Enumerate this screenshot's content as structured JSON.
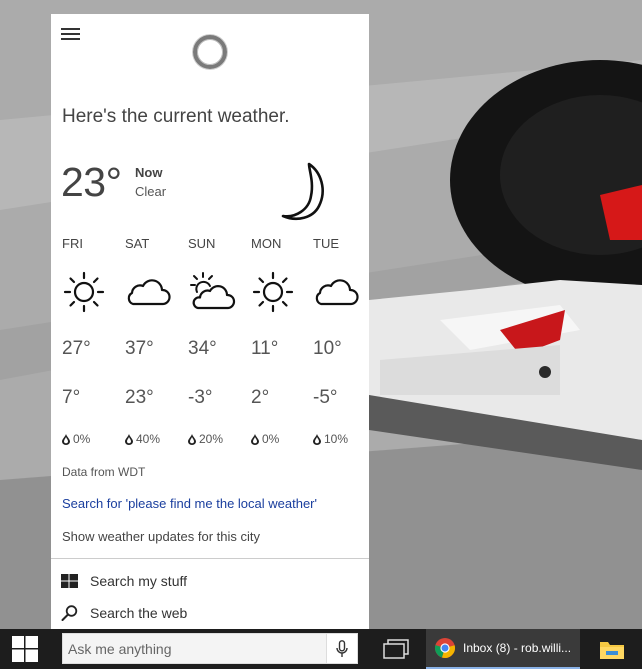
{
  "cortana": {
    "headline": "Here's the current weather.",
    "current": {
      "temp": "23°",
      "label": "Now",
      "condition": "Clear"
    },
    "forecast": [
      {
        "day": "FRI",
        "icon": "sun-icon",
        "high": "27°",
        "low": "7°",
        "precip": "0%"
      },
      {
        "day": "SAT",
        "icon": "cloud-icon",
        "high": "37°",
        "low": "23°",
        "precip": "40%"
      },
      {
        "day": "SUN",
        "icon": "partly-cloudy-icon",
        "high": "34°",
        "low": "-3°",
        "precip": "20%"
      },
      {
        "day": "MON",
        "icon": "sun-icon",
        "high": "11°",
        "low": "2°",
        "precip": "0%"
      },
      {
        "day": "TUE",
        "icon": "cloud-icon",
        "high": "10°",
        "low": "-5°",
        "precip": "10%"
      }
    ],
    "source": "Data from WDT",
    "search_link": "Search for 'please find me the local weather'",
    "updates_link": "Show weather updates for this city",
    "menu": {
      "my_stuff": "Search my stuff",
      "web": "Search the web"
    }
  },
  "taskbar": {
    "search_placeholder": "Ask me anything",
    "chrome_label": "Inbox (8) - rob.willi..."
  },
  "colors": {
    "link": "#1a3e9e",
    "taskbar": "#1d1d1d",
    "active_task_underline": "#8bb3e8"
  }
}
